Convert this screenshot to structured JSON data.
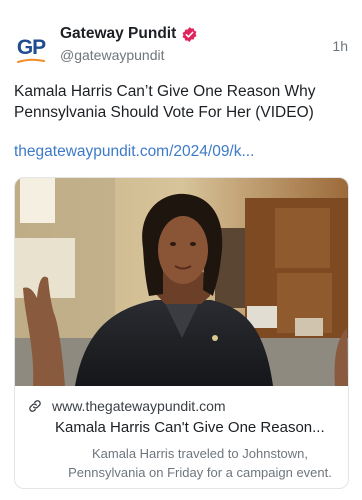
{
  "post": {
    "avatar_text": "GP",
    "display_name": "Gateway Pundit",
    "handle": "@gatewaypundit",
    "time": "1h",
    "text": "Kamala Harris Can’t Give One Reason Why Pennsylvania Should Vote For Her (VIDEO)",
    "link_text": "thegatewaypundit.com/2024/09/k..."
  },
  "card": {
    "domain": "www.thegatewaypundit.com",
    "title": "Kamala Harris Can't Give One Reason...",
    "description": "Kamala Harris traveled to Johnstown, Pennsylvania on Friday for a campaign event."
  },
  "colors": {
    "link": "#3d7ac7",
    "verified_badge": "#e0245e",
    "brand_blue": "#1f4d8f",
    "brand_orange": "#f28c28"
  },
  "icons": {
    "verified": "verified-badge-icon",
    "link": "link-icon"
  }
}
